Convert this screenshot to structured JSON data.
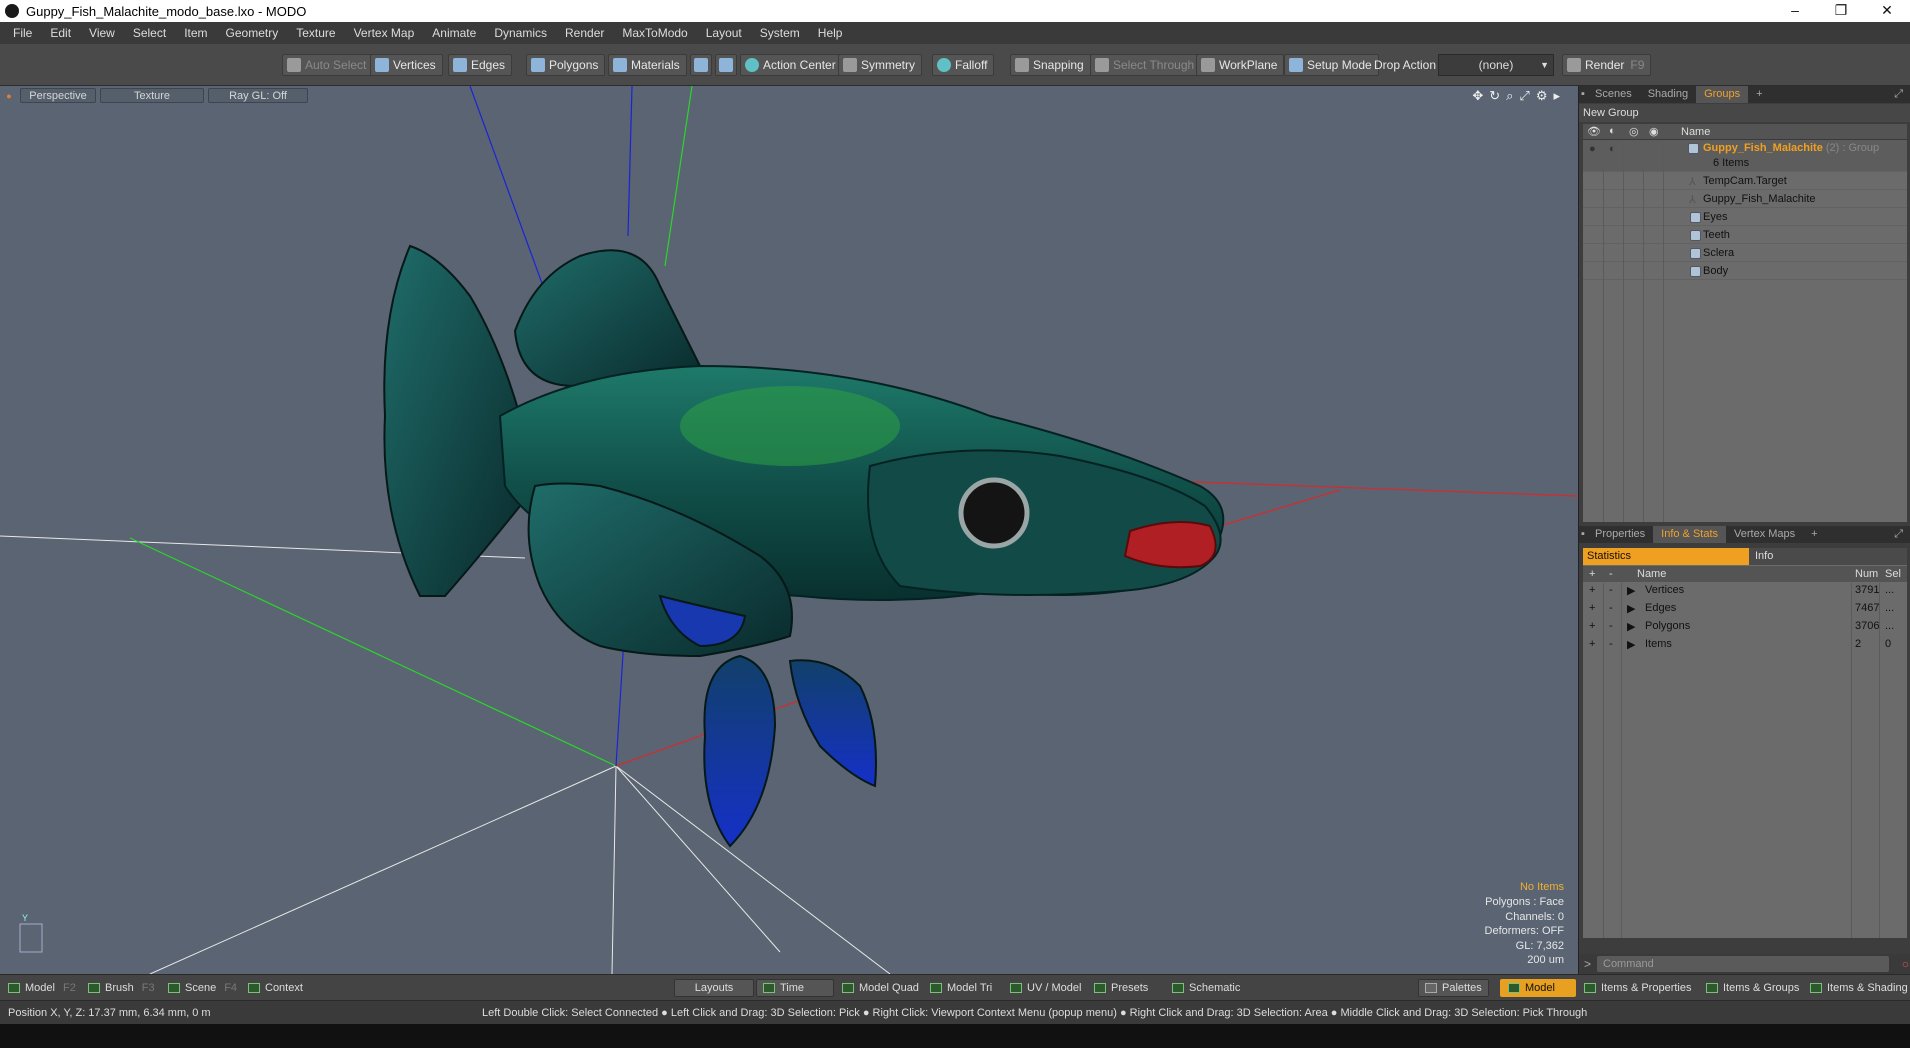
{
  "window": {
    "title": "Guppy_Fish_Malachite_modo_base.lxo - MODO",
    "minimize": "–",
    "maximize": "❐",
    "close": "✕"
  },
  "menu": [
    "File",
    "Edit",
    "View",
    "Select",
    "Item",
    "Geometry",
    "Texture",
    "Vertex Map",
    "Animate",
    "Dynamics",
    "Render",
    "MaxToModo",
    "Layout",
    "System",
    "Help"
  ],
  "toolbar": {
    "auto_select": "Auto Select",
    "vertices": "Vertices",
    "edges": "Edges",
    "polygons": "Polygons",
    "materials": "Materials",
    "action_center": "Action Center",
    "symmetry": "Symmetry",
    "falloff": "Falloff",
    "snapping": "Snapping",
    "select_through": "Select Through",
    "workplane": "WorkPlane",
    "setup_mode": "Setup Mode",
    "drop_action": "Drop Action",
    "drop_value": "(none)",
    "render": "Render",
    "render_key": "F9"
  },
  "viewport": {
    "view": "Perspective",
    "shading": "Texture",
    "raygl": "Ray GL: Off",
    "hud": {
      "selection": "No Items",
      "polygons": "Polygons : Face",
      "channels": "Channels: 0",
      "deformers": "Deformers: OFF",
      "gl": "GL: 7,362",
      "unit": "200 um"
    },
    "axis_label": "Y"
  },
  "groups_panel": {
    "tabs": [
      "Scenes",
      "Shading",
      "Groups"
    ],
    "active_tab": "Groups",
    "new_group": "New Group",
    "col_name": "Name",
    "group": {
      "name": "Guppy_Fish_Malachite",
      "count": "(2)",
      "type": ": Group",
      "items": "6 Items"
    },
    "items": [
      "TempCam.Target",
      "Guppy_Fish_Malachite",
      "Eyes",
      "Teeth",
      "Sclera",
      "Body"
    ]
  },
  "stats_panel": {
    "tabs": [
      "Properties",
      "Info & Stats",
      "Vertex Maps"
    ],
    "active_tab": "Info & Stats",
    "sub_tabs": [
      "Statistics",
      "Info"
    ],
    "headers": {
      "name": "Name",
      "num": "Num",
      "sel": "Sel"
    },
    "rows": [
      {
        "name": "Vertices",
        "num": "3791",
        "sel": "..."
      },
      {
        "name": "Edges",
        "num": "7467",
        "sel": "..."
      },
      {
        "name": "Polygons",
        "num": "3706",
        "sel": "..."
      },
      {
        "name": "Items",
        "num": "2",
        "sel": "0"
      }
    ]
  },
  "command": {
    "placeholder": "Command"
  },
  "bottom": {
    "model": "Model",
    "model_key": "F2",
    "brush": "Brush",
    "brush_key": "F3",
    "scene": "Scene",
    "scene_key": "F4",
    "context": "Context",
    "layouts": "Layouts",
    "time": "Time",
    "model_quad": "Model Quad",
    "model_tri": "Model Tri",
    "uv_model": "UV / Model",
    "presets": "Presets",
    "schematic": "Schematic",
    "palettes": "Palettes",
    "model_active": "Model",
    "items_properties": "Items & Properties",
    "items_groups": "Items & Groups",
    "items_shading": "Items & Shading"
  },
  "status": {
    "position": "Position X, Y, Z:   17.37 mm, 6.34 mm, 0 m",
    "help": "Left Double Click: Select Connected ● Left Click and Drag: 3D Selection: Pick ● Right Click: Viewport Context Menu (popup menu) ● Right Click and Drag: 3D Selection: Area ● Middle Click and Drag: 3D Selection: Pick Through"
  }
}
